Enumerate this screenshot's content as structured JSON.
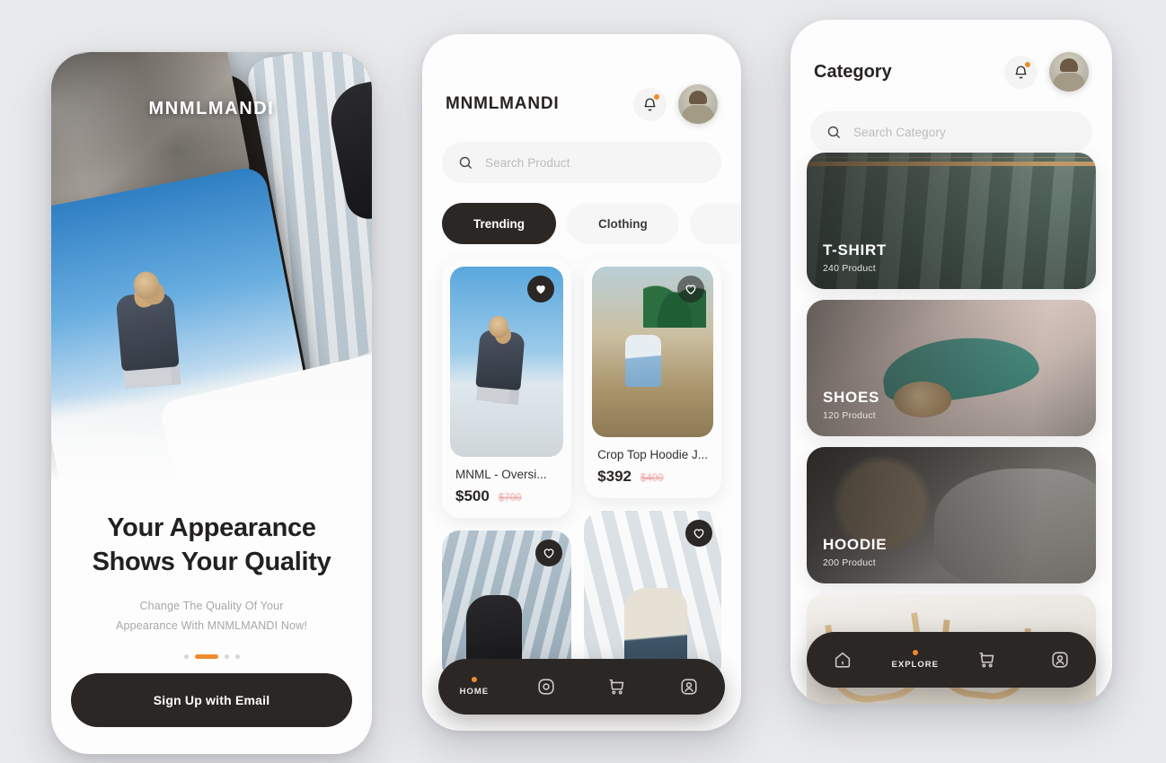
{
  "canvas": {
    "background": "#e9eaec"
  },
  "theme": {
    "dark": "#2b2725",
    "accent": "#ef8b2c",
    "card": "#fcfcfc",
    "muted": "#bdbbba"
  },
  "onboarding": {
    "brand": "MNMLMANDI",
    "title_line1": "Your Appearance",
    "title_line2": "Shows Your Quality",
    "subtitle_line1": "Change The Quality Of Your",
    "subtitle_line2": "Appearance With MNMLMANDI Now!",
    "cta_label": "Sign Up with Email",
    "pagination": {
      "total": 4,
      "active_index": 1
    }
  },
  "home": {
    "app_title": "MNMLMANDI",
    "bell_icon": "bell-icon",
    "has_notification": true,
    "avatar_icon": "avatar",
    "search": {
      "placeholder": "Search Product",
      "value": "",
      "icon": "search-icon"
    },
    "filters": [
      {
        "label": "Trending",
        "active": true
      },
      {
        "label": "Clothing",
        "active": false
      }
    ],
    "products_left": [
      {
        "name": "MNML - Oversi...",
        "price": "$500",
        "old_price": "$700",
        "favorited": true,
        "image": "skate-model-photo"
      },
      {
        "name": "",
        "price": "",
        "old_price": "",
        "favorited": false,
        "image": "glass-building-photo"
      }
    ],
    "products_right": [
      {
        "name": "Crop Top Hoodie J...",
        "price": "$392",
        "old_price": "$400",
        "favorited": false,
        "image": "palm-field-photo"
      },
      {
        "name": "",
        "price": "",
        "old_price": "",
        "favorited": false,
        "image": "white-corridor-photo"
      }
    ],
    "nav": [
      {
        "label": "HOME",
        "icon": "home-icon",
        "active": true
      },
      {
        "label": "",
        "icon": "explore-icon",
        "active": false
      },
      {
        "label": "",
        "icon": "cart-icon",
        "active": false
      },
      {
        "label": "",
        "icon": "profile-icon",
        "active": false
      }
    ]
  },
  "category": {
    "page_title": "Category",
    "bell_icon": "bell-icon",
    "has_notification": true,
    "avatar_icon": "avatar",
    "search": {
      "placeholder": "Search Category",
      "value": "",
      "icon": "search-icon"
    },
    "cards": [
      {
        "name": "T-SHIRT",
        "count": "240 Product",
        "image": "green-tshirts-on-hangers"
      },
      {
        "name": "SHOES",
        "count": "120 Product",
        "image": "teal-suede-shoe"
      },
      {
        "name": "HOODIE",
        "count": "200 Product",
        "image": "grey-hoodie-man"
      },
      {
        "name": "",
        "count": "",
        "image": "wooden-hangers-rack"
      }
    ],
    "nav": [
      {
        "label": "",
        "icon": "home-icon",
        "active": false
      },
      {
        "label": "EXPLORE",
        "icon": "explore-icon",
        "active": true
      },
      {
        "label": "",
        "icon": "cart-icon",
        "active": false
      },
      {
        "label": "",
        "icon": "profile-icon",
        "active": false
      }
    ]
  }
}
